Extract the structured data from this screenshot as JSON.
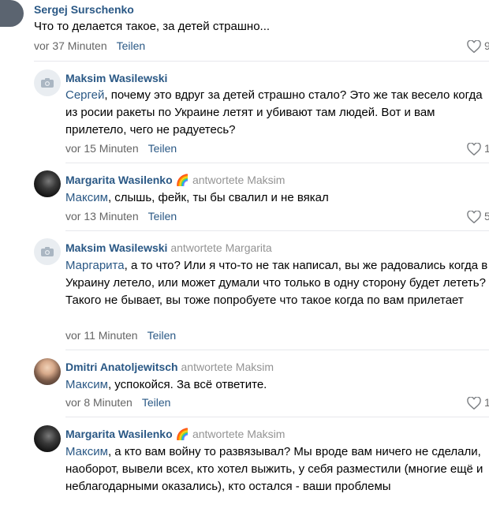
{
  "comments": [
    {
      "author": "Sergej Surschenko",
      "text": "Что то делается такое, за детей страшно...",
      "time": "vor 37 Minuten",
      "reply_label": "Teilen",
      "likes": "9"
    },
    {
      "author": "Maksim Wasilewski",
      "mention": "Сергей",
      "text": ", почему это вдруг за детей страшно стало? Это же так весело когда из росии ракеты по Украине летят и убивают там людей. Вот и вам прилетело, чего не радуетесь?",
      "time": "vor 15 Minuten",
      "reply_label": "Teilen",
      "likes": "1"
    },
    {
      "author": "Margarita Wasilenko",
      "emoji": "🌈",
      "replied": "antwortete Maksim",
      "mention": "Максим",
      "text": ", слышь, фейк, ты бы свалил и не вякал",
      "time": "vor 13 Minuten",
      "reply_label": "Teilen",
      "likes": "5"
    },
    {
      "author": "Maksim Wasilewski",
      "replied": "antwortete Margarita",
      "mention": "Маргарита",
      "text": ", а то что? Или я что-то не так написал, вы же радовались когда в Украину летело, или может думали что только в одну сторону будет лететь? Такого не бывает, вы тоже попробуете что такое когда по вам прилетает",
      "time": "vor 11 Minuten",
      "reply_label": "Teilen"
    },
    {
      "author": "Dmitri Anatoljewitsch",
      "replied": "antwortete Maksim",
      "mention": "Максим",
      "text": ", успокойся. За всё ответите.",
      "time": "vor 8 Minuten",
      "reply_label": "Teilen",
      "likes": "1"
    },
    {
      "author": "Margarita Wasilenko",
      "emoji": "🌈",
      "replied": "antwortete Maksim",
      "mention": "Максим",
      "text": ", а кто вам войну то развязывал? Мы вроде вам ничего не сделали, наоборот, вывели всех, кто хотел выжить, у себя разместили (многие ещё и неблагодарными оказались), кто остался - ваши проблемы"
    }
  ]
}
